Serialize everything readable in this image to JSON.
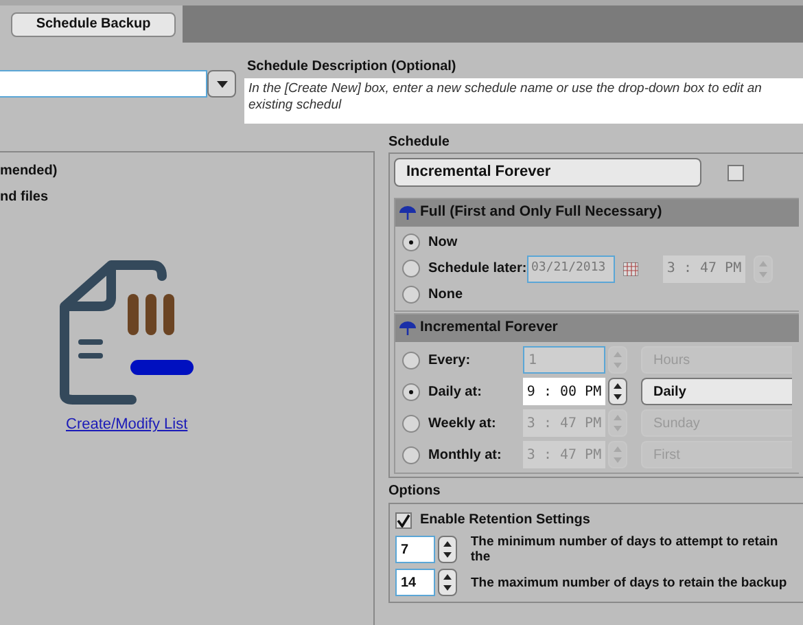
{
  "tabs": [
    {
      "label": "Schedule Backup",
      "selected": true
    }
  ],
  "description": {
    "label": "Schedule Description (Optional)",
    "value": "In the [Create New] box, enter a new schedule name or use the drop-down box to edit an existing schedul"
  },
  "source": {
    "lines": [
      "mended)",
      "nd files"
    ],
    "link": "Create/Modify List"
  },
  "schedule": {
    "label": "Schedule",
    "type": "Incremental Forever",
    "checkbox": {
      "checked": false
    },
    "full": {
      "title": "Full (First and Only Full Necessary)",
      "options": [
        {
          "label": "Now",
          "selected": true
        },
        {
          "label": "Schedule later:",
          "selected": false,
          "date": "03/21/2013",
          "time": "3 : 47 PM"
        },
        {
          "label": "None",
          "selected": false
        }
      ]
    },
    "incremental": {
      "title": "Incremental Forever",
      "options": [
        {
          "label": "Every:",
          "selected": false,
          "disabled": true,
          "value": "1",
          "unit": "Hours"
        },
        {
          "label": "Daily at:",
          "selected": true,
          "disabled": false,
          "value": "9 : 00 PM",
          "unit": "Daily"
        },
        {
          "label": "Weekly at:",
          "selected": false,
          "disabled": true,
          "value": "3 : 47 PM",
          "unit": "Sunday"
        },
        {
          "label": "Monthly at:",
          "selected": false,
          "disabled": true,
          "value": "3 : 47 PM",
          "unit": "First"
        }
      ]
    }
  },
  "options": {
    "label": "Options",
    "retention": {
      "label": "Enable Retention Settings",
      "checked": true
    },
    "fields": [
      {
        "value": "7",
        "description": "The minimum number of days to attempt to retain the"
      },
      {
        "value": "14",
        "description": "The maximum number of days to retain the backup"
      }
    ]
  }
}
